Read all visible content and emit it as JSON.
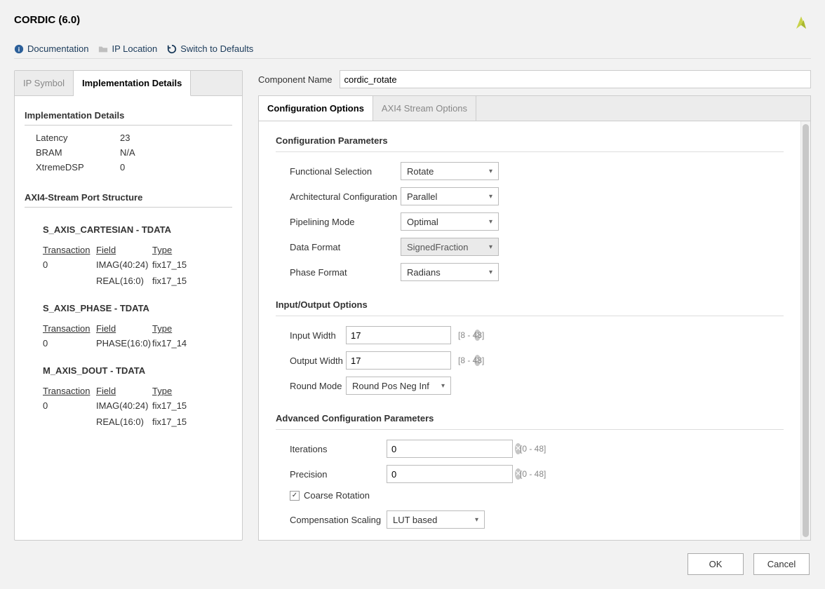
{
  "title": "CORDIC (6.0)",
  "toolbar": {
    "doc": "Documentation",
    "loc": "IP Location",
    "defaults": "Switch to Defaults"
  },
  "left": {
    "tabs": {
      "symbol": "IP Symbol",
      "impl": "Implementation Details"
    },
    "impl_title": "Implementation Details",
    "kv": [
      {
        "k": "Latency",
        "v": "23"
      },
      {
        "k": "BRAM",
        "v": "N/A"
      },
      {
        "k": "XtremeDSP",
        "v": "0"
      }
    ],
    "port_struct_title": "AXI4-Stream Port Structure",
    "ports": [
      {
        "title": "S_AXIS_CARTESIAN - TDATA",
        "rows": [
          {
            "trans": "0",
            "field": "IMAG(40:24)",
            "type": "fix17_15"
          },
          {
            "trans": "",
            "field": "REAL(16:0)",
            "type": "fix17_15"
          }
        ]
      },
      {
        "title": "S_AXIS_PHASE - TDATA",
        "rows": [
          {
            "trans": "0",
            "field": "PHASE(16:0)",
            "type": "fix17_14"
          }
        ]
      },
      {
        "title": "M_AXIS_DOUT - TDATA",
        "rows": [
          {
            "trans": "0",
            "field": "IMAG(40:24)",
            "type": "fix17_15"
          },
          {
            "trans": "",
            "field": "REAL(16:0)",
            "type": "fix17_15"
          }
        ]
      }
    ],
    "col_headers": {
      "trans": "Transaction",
      "field": "Field",
      "type": "Type"
    }
  },
  "right": {
    "component_name_label": "Component Name",
    "component_name_value": "cordic_rotate",
    "tabs": {
      "config": "Configuration Options",
      "axi": "AXI4 Stream Options"
    },
    "config_params": {
      "title": "Configuration Parameters",
      "functional_selection": {
        "label": "Functional Selection",
        "value": "Rotate"
      },
      "arch_config": {
        "label": "Architectural Configuration",
        "value": "Parallel"
      },
      "pipelining_mode": {
        "label": "Pipelining Mode",
        "value": "Optimal"
      },
      "data_format": {
        "label": "Data Format",
        "value": "SignedFraction",
        "disabled": true
      },
      "phase_format": {
        "label": "Phase Format",
        "value": "Radians"
      }
    },
    "io": {
      "title": "Input/Output Options",
      "input_width": {
        "label": "Input Width",
        "value": "17",
        "range": "[8 - 48]"
      },
      "output_width": {
        "label": "Output Width",
        "value": "17",
        "range": "[8 - 48]"
      },
      "round_mode": {
        "label": "Round Mode",
        "value": "Round Pos Neg Inf"
      }
    },
    "adv": {
      "title": "Advanced Configuration Parameters",
      "iterations": {
        "label": "Iterations",
        "value": "0",
        "range": "[0 - 48]"
      },
      "precision": {
        "label": "Precision",
        "value": "0",
        "range": "[0 - 48]"
      },
      "coarse_label": "Coarse Rotation",
      "comp_scaling": {
        "label": "Compensation Scaling",
        "value": "LUT based"
      }
    }
  },
  "footer": {
    "ok": "OK",
    "cancel": "Cancel"
  }
}
